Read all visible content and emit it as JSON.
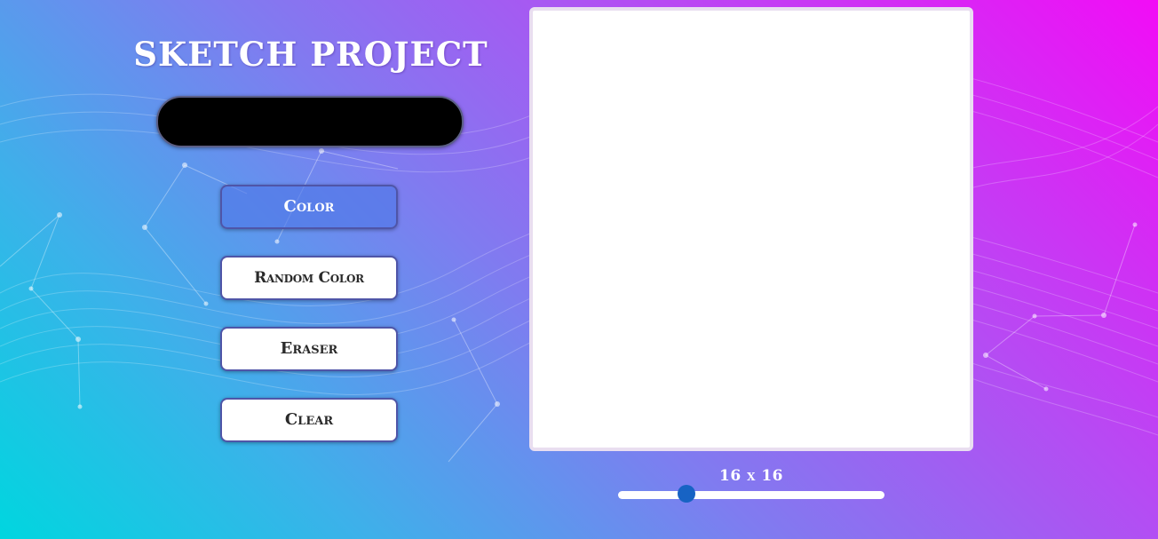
{
  "app": {
    "title": "SKETCH PROJECT"
  },
  "color_picker": {
    "current_color": "#000000"
  },
  "controls": {
    "color_label": "Color",
    "random_color_label": "Random Color",
    "eraser_label": "Eraser",
    "clear_label": "Clear"
  },
  "grid": {
    "size_label": "16 x 16",
    "slider_value": 16,
    "slider_min": 1,
    "slider_max": 64
  },
  "colors": {
    "accent": "#1763c4",
    "canvas_background": "#ffffff"
  }
}
